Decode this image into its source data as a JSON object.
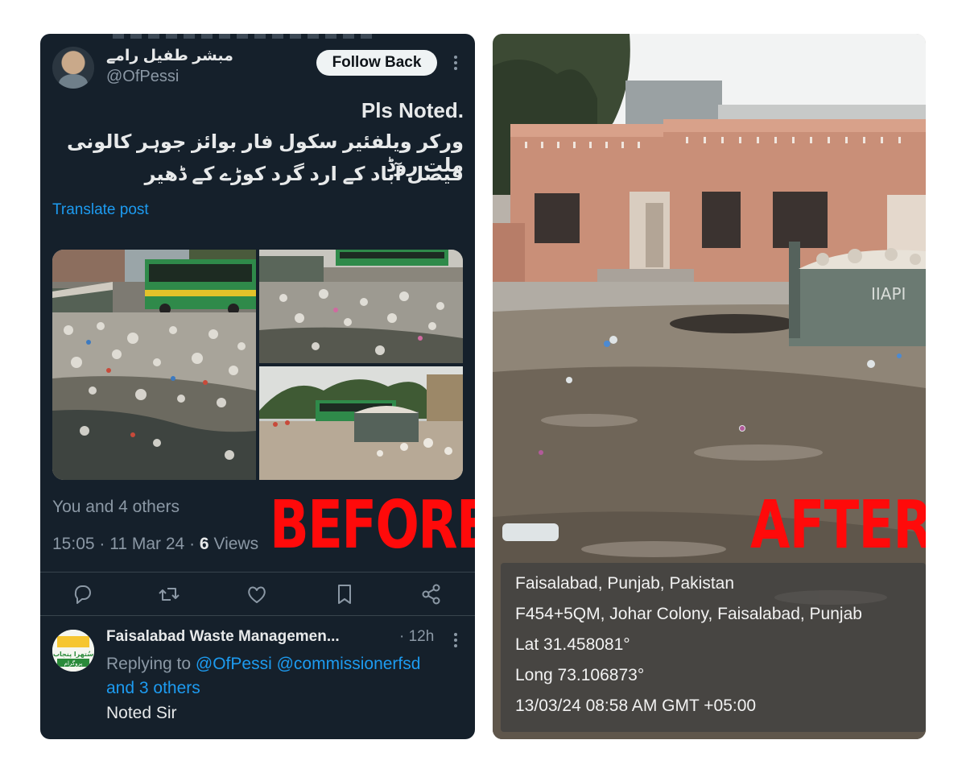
{
  "tweet": {
    "author_name": "مبشر طفیل رامے",
    "author_handle": "@OfPessi",
    "follow_label": "Follow Back",
    "text_line1": "Pls Noted.",
    "text_line2": "ورکر ویلفئیر سکول فار بوائز جوہر کالونی ملت روڈ",
    "text_line3": "فیصل آباد کے ارد گرد کوڑے کے ڈھیر",
    "translate_label": "Translate post",
    "reactions": "You and 4 others",
    "time": "15:05",
    "date": "11 Mar 24",
    "views_count": "6",
    "views_label": "Views",
    "photos": [
      "garbage-bus-street",
      "garbage-road-bus",
      "garbage-container-trees"
    ]
  },
  "actions": [
    "reply-icon",
    "repost-icon",
    "like-icon",
    "bookmark-icon",
    "share-icon"
  ],
  "reply": {
    "author_name": "Faisalabad Waste Managemen...",
    "time": "· 12h",
    "replying_prefix": "Replying to",
    "mentions": "@OfPessi @commissionerfsd",
    "others": "and 3 others",
    "text": "Noted Sir",
    "logo_text_top": "سُتھرا پنجاب",
    "logo_text_bottom": "پروگرام"
  },
  "labels": {
    "before": "BEFORE",
    "after": "AFTER"
  },
  "geotag": {
    "line1": "Faisalabad, Punjab, Pakistan",
    "line2": "F454+5QM, Johar Colony, Faisalabad, Punjab",
    "line3": "Lat 31.458081°",
    "line4": "Long 73.106873°",
    "line5": "13/03/24 08:58 AM GMT +05:00"
  },
  "colors": {
    "tweet_bg": "#15202b",
    "link_blue": "#1d9bf0",
    "stamp_red": "#ff0a0a"
  }
}
